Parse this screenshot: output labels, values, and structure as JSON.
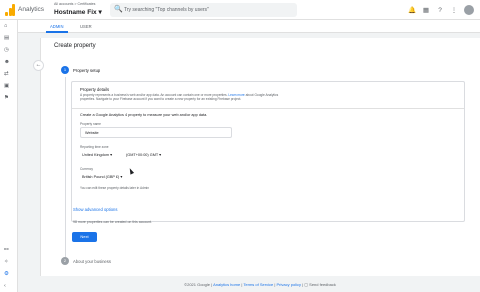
{
  "app": {
    "title": "Analytics",
    "breadcrumb": "All accounts > Certificates",
    "property_name": "Hostname Fix",
    "search_placeholder": "Try searching \"Top channels by users\""
  },
  "topbar_icons": [
    "notifications-icon",
    "apps-icon",
    "help-icon",
    "more-vert-icon",
    "avatar"
  ],
  "top_glyphs": {
    "search": "🔍",
    "dropdown": "▾",
    "notifications": "🔔",
    "apps": "▦",
    "help": "?",
    "more": "⋮"
  },
  "sidenav_glyphs": {
    "home": "⌂",
    "reports": "▤",
    "explore": "◷",
    "audience": "☻",
    "configure": "⚙",
    "share": "⇄",
    "ads": "▣",
    "flag": "⚑",
    "link": "⚯",
    "lightbulb": "✧",
    "settings": "⚙",
    "collapse": "‹"
  },
  "tabs": [
    {
      "label": "ADMIN"
    },
    {
      "label": "USER"
    }
  ],
  "page": {
    "title": "Create property",
    "back_glyph": "←",
    "steps": [
      {
        "number": "1",
        "label": "Property setup"
      },
      {
        "number": "2",
        "label": "About your business"
      }
    ]
  },
  "details": {
    "title": "Property details",
    "text": "A property represents a business's web and/or app data. An account can contain one or more properties.",
    "link_text": "Learn more",
    "text2": "about Google Analytics properties. Navigate to your Firebase account if you want to create a new property for an existing Firebase project."
  },
  "form": {
    "create_text": "Create a Google Analytics 4 property to measure your web and/or app data.",
    "property_name_label": "Property name",
    "property_name_value": "Website",
    "time_zone_label": "Reporting time zone",
    "country_value": "United Kingdom",
    "timezone_value": "(GMT+00:00) GMT",
    "currency_label": "Currency",
    "currency_value": "British Pound (GBP £)",
    "note": "You can edit these property details later in Admin",
    "caret": "▾"
  },
  "advanced_options": "Show advanced options",
  "remaining": "98 more properties can be created on this account.",
  "next_button": "Next",
  "footer": {
    "copyright": "©2021 Google",
    "home": "Analytics home",
    "tos": "Terms of Service",
    "privacy": "Privacy policy",
    "feedback": "Send feedback",
    "feedback_glyph": "▢",
    "sep": "|"
  },
  "colors": {
    "accent": "#1a73e8",
    "brand": "#f9ab00"
  }
}
